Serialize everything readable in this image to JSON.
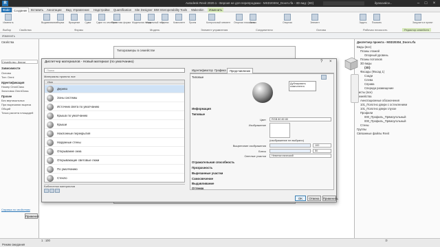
{
  "titlebar": {
    "logo": "R",
    "title": "Autodesk Revit 2020.1 - Версия не для перепродажи - MSD20304_Doors.rfa - 3D вид: {3D}",
    "user": "ilyasuvalov..."
  },
  "tabs": [
    "Файл",
    "Создание",
    "Вставить",
    "Аннотации",
    "Вид",
    "Управление",
    "Надстройки",
    "Quantification",
    "Site Designer",
    "BIM Interoperability Tools",
    "Wakeskin",
    "Изменить"
  ],
  "active_tab": "Создание",
  "ribbon": {
    "buttons": [
      "Изменить",
      "Выдавливание",
      "Форма",
      "Вращение",
      "Сдвиг",
      "Сдвиг по сечениям",
      "Пустотная форма",
      "Модельная линия",
      "Модельный текст",
      "Группа",
      "Компонент",
      "Проем",
      "Контрольный элемент",
      "Опорная плоскость",
      "Линия",
      "Опорная",
      "Элемент",
      "Задать",
      "Показать",
      "Загрузить в проект"
    ],
    "groups": [
      "Выбор",
      "Свойства",
      "Формы",
      "Модель",
      "Элемент управления",
      "Соединители",
      "Основа",
      "Рабочая плоскость",
      "Редактор семейств"
    ]
  },
  "optbar": {
    "mode": "Изменить"
  },
  "left_panel": {
    "title": "Свойства",
    "family": "Семейство: Двери",
    "section1": "Зависимости",
    "rows1": [
      "Основа",
      "Тип: Оmni"
    ],
    "section2": "Идентификация",
    "rows2": [
      "Номер OmniClass",
      "Заголовок OmniClass"
    ],
    "section3": "Прочее",
    "rows3": [
      "Без вертикальных",
      "При вырезании выреза",
      "Общий",
      "Точка расчета площадей"
    ],
    "help_link": "Справка по свойствам",
    "apply": "Применить"
  },
  "right_panel": {
    "title": "Диспетчер проекта - MSD20304_Doors.rfa",
    "tree": [
      "Виды (все)",
      "Планы этажей",
      "Опорный уровень",
      "Планы потолков",
      "3D виды",
      "{3D}",
      "Фасады (Фасад 1)",
      "Сзади",
      "Слева",
      "Справа",
      "Спереди размещение",
      "Листы (все)",
      "Семейства",
      "Аннотационные обозначения",
      "101_Полотно двери с остеклением",
      "101_Полотно двери глухое",
      "Профили",
      "000_Профиль_Прямоугольный",
      "000_Профиль_Прямоугольный",
      "Стены",
      "Группы",
      "Связанные файлы Revit"
    ]
  },
  "bg_dialog": {
    "title": "Типоразмеры в семействе"
  },
  "dialog": {
    "title": "Диспетчер материалов - Новый материал (по умолчанию)",
    "help": "?",
    "close": "×",
    "search_placeholder": "Поиск",
    "library_filter": "Материалы проекта: все",
    "column_header": "Имя",
    "materials": [
      "Дерево",
      "Зоны системы",
      "Источник света по умолчанию",
      "Крыша по умолчанию",
      "Крыши",
      "Наклонные перекрытия",
      "Наружные стены",
      "Открывание окна",
      "Открывающие световые люки",
      "По умолчанию",
      "Стекло"
    ],
    "selected_material": "Дерево",
    "library_label": "Библиотека материалов",
    "right_tabs": [
      "Идентификатор",
      "Графика",
      "Представление"
    ],
    "active_right_tab": "Представление",
    "asset_name": "Типовые",
    "sections": [
      "Информация",
      "Типовые",
      "Отражательная способность",
      "Прозрачность",
      "Вырезанные участки",
      "Самосвечение",
      "Выдавливание",
      "Оттенок"
    ],
    "props": {
      "color_label": "Цвет",
      "color_value": "RGB 80 80 80",
      "image_label": "Изображение",
      "image_none": "(изображение не выбрано)",
      "fade_label": "Выцветание изображения",
      "fade_value": "100",
      "gloss_label": "Блеск",
      "gloss_value": "50",
      "highlights_label": "Светлые участки",
      "highlights_value": "Неметаллический"
    },
    "tooltip": "Дублировать компонента",
    "ok": "OK",
    "cancel": "Отмена",
    "apply": "Применить"
  },
  "status": {
    "left": "Режим ожидания",
    "scale": "1 : 100",
    "zero": ":0"
  }
}
